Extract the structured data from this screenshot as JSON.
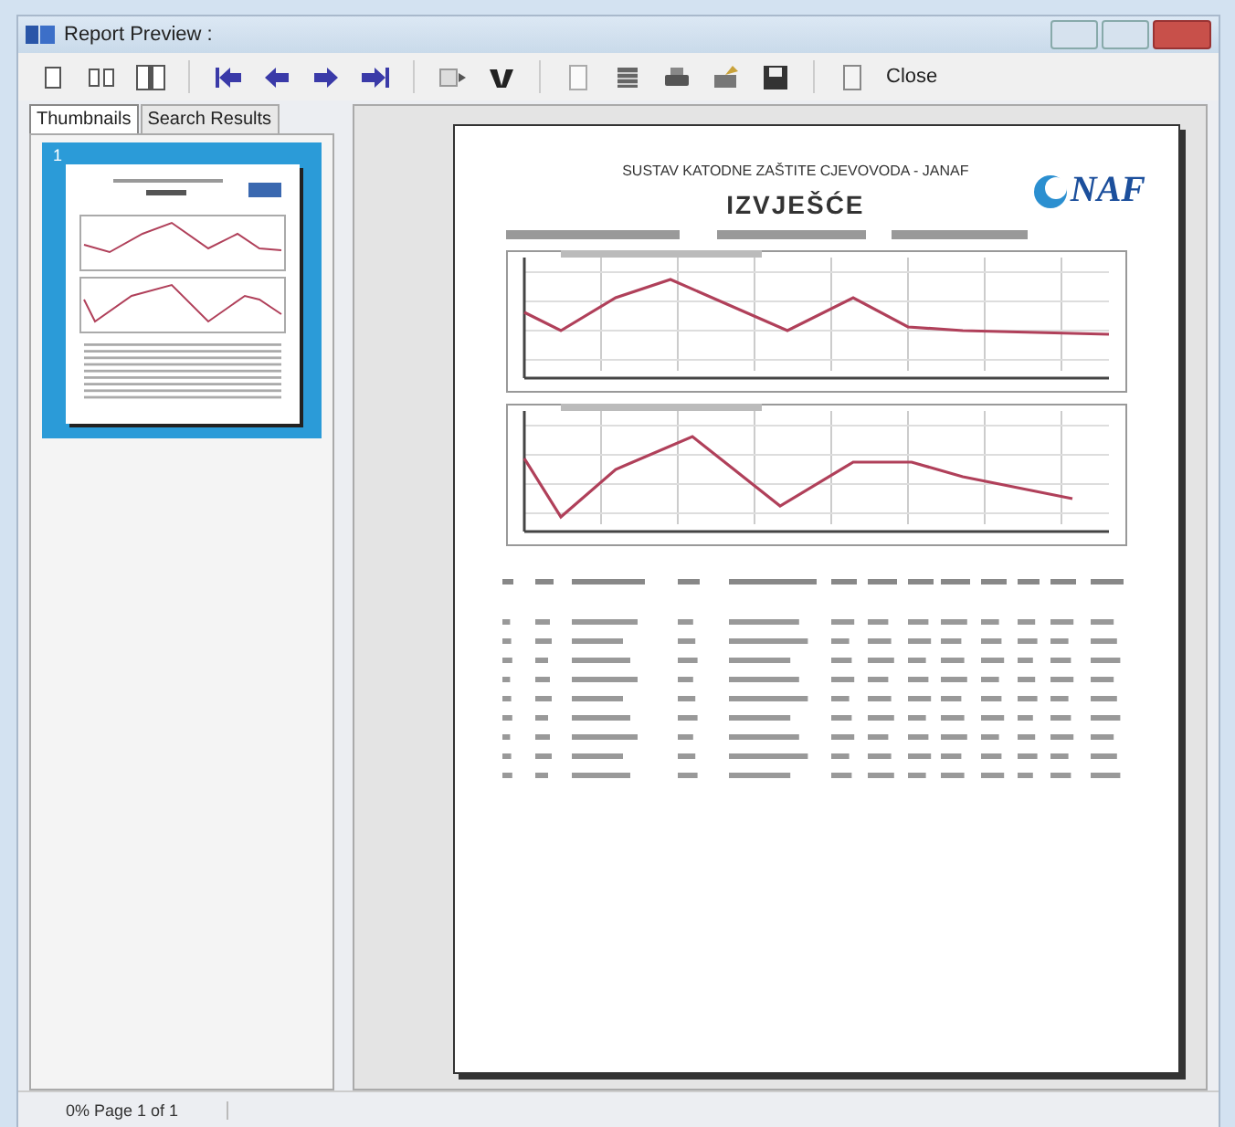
{
  "window": {
    "title": "Report Preview :"
  },
  "toolbar": {
    "buttons": [
      {
        "kind": "single-page"
      },
      {
        "kind": "two-pages"
      },
      {
        "kind": "page-width"
      },
      {
        "kind": "first"
      },
      {
        "kind": "previous"
      },
      {
        "kind": "next"
      },
      {
        "kind": "last"
      },
      {
        "kind": "goto"
      },
      {
        "kind": "find"
      },
      {
        "kind": "new"
      },
      {
        "kind": "pages"
      },
      {
        "kind": "print"
      },
      {
        "kind": "export"
      },
      {
        "kind": "save"
      },
      {
        "kind": "blank"
      }
    ],
    "close_label": "Close"
  },
  "tabs": [
    {
      "label": "Thumbnails",
      "selected": true
    },
    {
      "label": "Search Results",
      "selected": false
    }
  ],
  "thumbnails": [
    {
      "number": "1",
      "selected": true
    }
  ],
  "report": {
    "header": "SUSTAV KATODNE ZAŠTITE CJEVOVODA - JANAF",
    "title": "IZVJEŠĆE",
    "logo_text": "NAF"
  },
  "status_bar": {
    "text": "0% Page 1 of 1"
  }
}
